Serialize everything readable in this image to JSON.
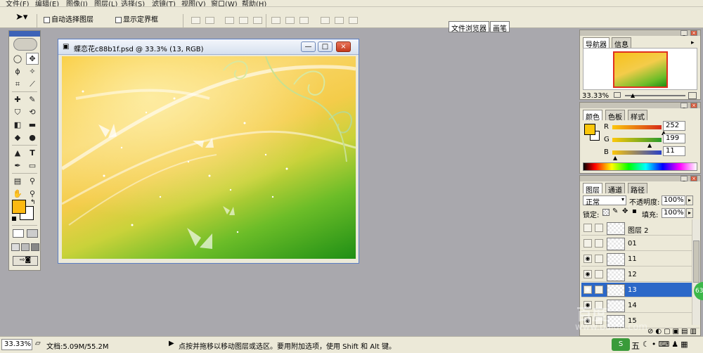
{
  "menu": [
    "文件(F)",
    "编辑(E)",
    "图像(I)",
    "图层(L)",
    "选择(S)",
    "滤镜(T)",
    "视图(V)",
    "窗口(W)",
    "帮助(H)"
  ],
  "options": {
    "auto_select": "自动选择图层",
    "show_bounds": "显示定界框"
  },
  "workspace_tabs": [
    "文件浏览器",
    "画笔"
  ],
  "document": {
    "title": "蝶恋花c88b1f.psd @ 33.3% (13, RGB)",
    "min": "—",
    "max": "□",
    "close": "×"
  },
  "navigator": {
    "tab1": "导航器",
    "tab2": "信息",
    "zoom": "33.33%"
  },
  "color_panel": {
    "tab1": "颜色",
    "tab2": "色板",
    "tab3": "样式",
    "channels": [
      {
        "label": "R",
        "value": "252",
        "color": "#d62b1a"
      },
      {
        "label": "G",
        "value": "199",
        "color": "#2a9a2a"
      },
      {
        "label": "B",
        "value": "11",
        "color": "#2840c8"
      }
    ],
    "swatch": "#fcc70b"
  },
  "layers_panel": {
    "tab1": "图层",
    "tab2": "通道",
    "tab3": "路径",
    "blend": "正常",
    "opacity_label": "不透明度:",
    "opacity": "100%",
    "lock_label": "锁定:",
    "fill_label": "填充:",
    "fill": "100%",
    "layers": [
      {
        "name": "图层 2",
        "visible": false,
        "selected": false
      },
      {
        "name": "01",
        "visible": false,
        "selected": false
      },
      {
        "name": "11",
        "visible": true,
        "selected": false
      },
      {
        "name": "12",
        "visible": true,
        "selected": false
      },
      {
        "name": "13",
        "visible": true,
        "selected": true
      },
      {
        "name": "14",
        "visible": true,
        "selected": false
      },
      {
        "name": "15",
        "visible": true,
        "selected": false
      }
    ]
  },
  "status": {
    "zoom": "33.33%",
    "doc": "文档:5.09M/55.2M",
    "hint": "点按并拖移以移动图层或选区。要用附加选项，使用 Shift 和 Alt 键。"
  },
  "taskbar": {
    "ime": "五",
    "badge": "63"
  },
  "watermark": "www.baidu.com",
  "colors": {
    "foreground": "#fcb912",
    "background": "#ffffff",
    "selection": "#2c68c8"
  }
}
